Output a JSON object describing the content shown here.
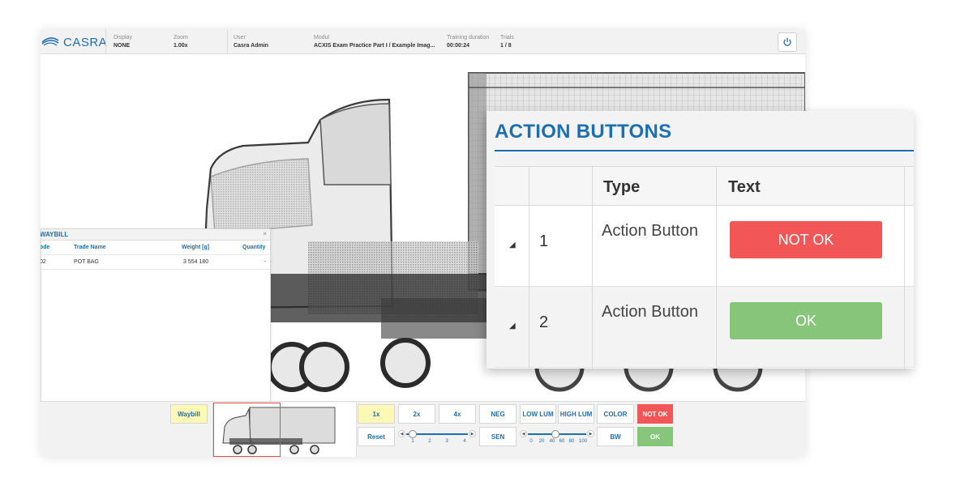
{
  "header": {
    "logo_text": "CASRA",
    "display": {
      "label": "Display",
      "value": "NONE"
    },
    "zoom": {
      "label": "Zoom",
      "value": "1.00x"
    },
    "user": {
      "label": "User",
      "value": "Casra Admin"
    },
    "modul": {
      "label": "Modul",
      "value": "ACXIS Exam Practice Part I / Example Imag..."
    },
    "training_duration": {
      "label": "Training duration",
      "value": "00:00:24"
    },
    "trials": {
      "label": "Trials",
      "value": "1 / 8"
    },
    "power_icon": "power-icon"
  },
  "waybill": {
    "title": "WAYBILL",
    "close": "×",
    "columns": [
      "ode",
      "Trade Name",
      "Weight [g]",
      "Quantity"
    ],
    "rows": [
      {
        "code": "02",
        "trade_name": "POT BAG",
        "weight": "3 554 180",
        "quantity": "-"
      }
    ]
  },
  "toolbar": {
    "waybill": "Waybill",
    "zoom_1x": "1x",
    "zoom_2x": "2x",
    "zoom_4x": "4x",
    "reset": "Reset",
    "neg": "NEG",
    "sen": "SEN",
    "low_lum": "LOW LUM",
    "high_lum": "HIGH LUM",
    "color": "COLOR",
    "bw": "BW",
    "not_ok": "NOT OK",
    "ok": "OK",
    "zoom_slider_ticks": [
      "1",
      "2",
      "3",
      "4"
    ],
    "zoom_slider_value": 1,
    "lum_slider_ticks": [
      "0",
      "20",
      "40",
      "60",
      "80",
      "100"
    ],
    "lum_slider_value": 40
  },
  "action_panel": {
    "title": "ACTION BUTTONS",
    "columns": {
      "type": "Type",
      "text": "Text"
    },
    "rows": [
      {
        "num": "1",
        "type": "Action Button",
        "text": "NOT OK",
        "color": "#f25656"
      },
      {
        "num": "2",
        "type": "Action Button",
        "text": "OK",
        "color": "#87c57b"
      }
    ]
  },
  "colors": {
    "accent": "#1d6fb3",
    "not_ok": "#f25656",
    "ok": "#87c57b",
    "highlight": "#fcf8b5"
  }
}
